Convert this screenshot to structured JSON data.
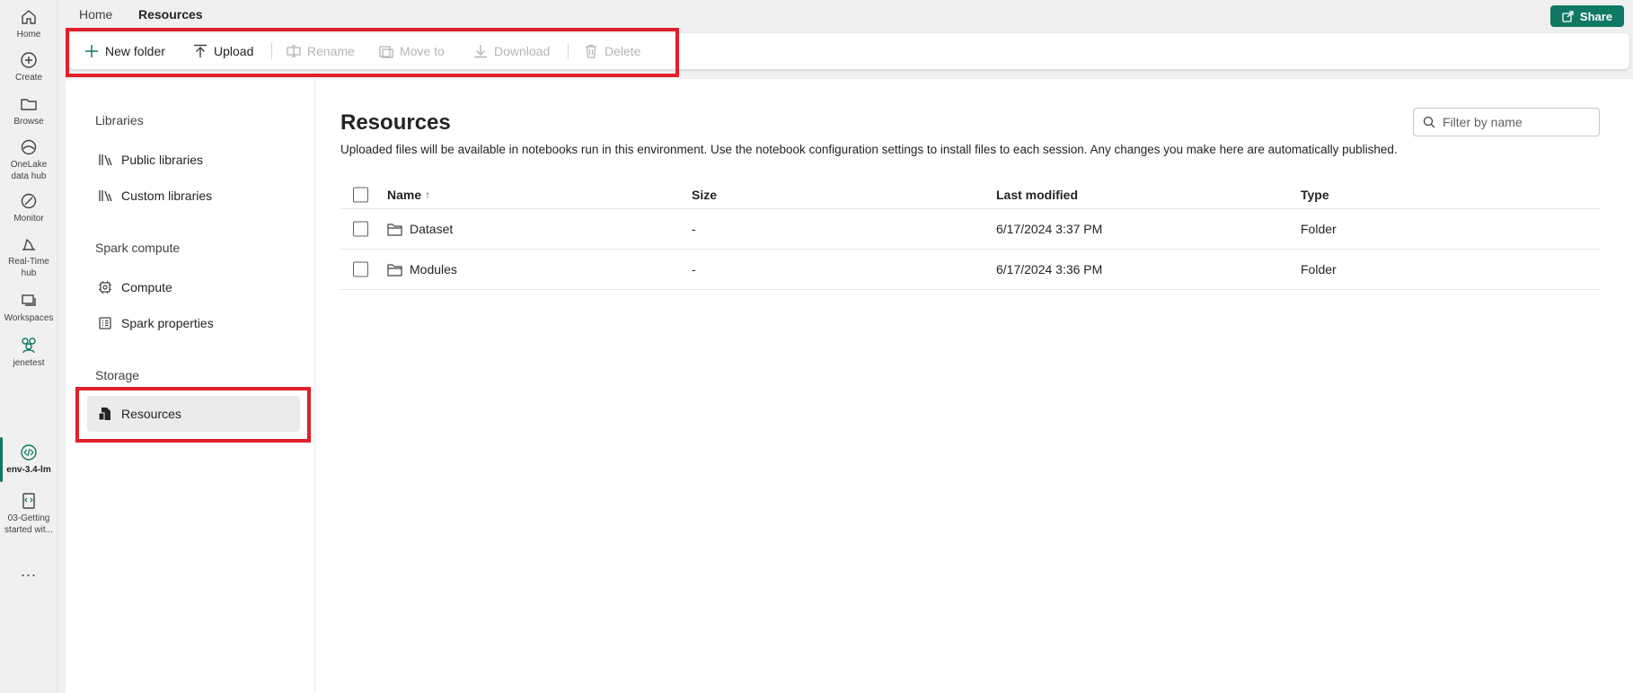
{
  "rail": {
    "items": [
      {
        "label": "Home"
      },
      {
        "label": "Create"
      },
      {
        "label": "Browse"
      },
      {
        "label_line1": "OneLake",
        "label_line2": "data hub"
      },
      {
        "label": "Monitor"
      },
      {
        "label_line1": "Real-Time",
        "label_line2": "hub"
      },
      {
        "label": "Workspaces"
      },
      {
        "label": "jenetest"
      },
      {
        "label": "env-3.4-lm"
      },
      {
        "label_line1": "03-Getting",
        "label_line2": "started wit..."
      }
    ],
    "more": "..."
  },
  "breadcrumb": {
    "home": "Home",
    "current": "Resources"
  },
  "share_label": "Share",
  "toolbar": {
    "new_folder": "New folder",
    "upload": "Upload",
    "rename": "Rename",
    "move_to": "Move to",
    "download": "Download",
    "delete": "Delete"
  },
  "subnav": {
    "libraries_heading": "Libraries",
    "public_libraries": "Public libraries",
    "custom_libraries": "Custom libraries",
    "spark_heading": "Spark compute",
    "compute": "Compute",
    "spark_properties": "Spark properties",
    "storage_heading": "Storage",
    "resources": "Resources"
  },
  "content": {
    "title": "Resources",
    "description": "Uploaded files will be available in notebooks run in this environment. Use the notebook configuration settings to install files to each session. Any changes you make here are automatically published.",
    "filter_placeholder": "Filter by name"
  },
  "table": {
    "headers": {
      "name": "Name",
      "sort_indicator": "↑",
      "size": "Size",
      "last_modified": "Last modified",
      "type": "Type"
    },
    "rows": [
      {
        "name": "Dataset",
        "size": "-",
        "last_modified": "6/17/2024 3:37 PM",
        "type": "Folder"
      },
      {
        "name": "Modules",
        "size": "-",
        "last_modified": "6/17/2024 3:36 PM",
        "type": "Folder"
      }
    ]
  },
  "colors": {
    "accent": "#117865",
    "highlight": "#e0202a"
  }
}
